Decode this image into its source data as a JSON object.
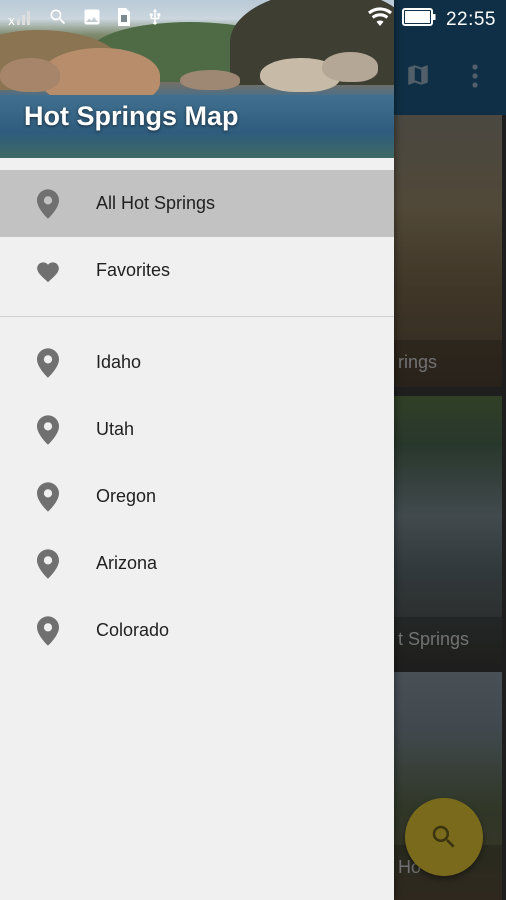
{
  "status_bar": {
    "time": "22:55",
    "icons": [
      "signal-x-icon",
      "search-icon",
      "image-icon",
      "sim-icon",
      "usb-icon",
      "wifi-icon",
      "battery-icon"
    ]
  },
  "drawer": {
    "title": "Hot Springs Map",
    "primary_items": [
      {
        "label": "All Hot Springs",
        "icon": "location-pin-icon",
        "selected": true
      },
      {
        "label": "Favorites",
        "icon": "heart-icon",
        "selected": false
      }
    ],
    "state_items": [
      {
        "label": "Idaho",
        "icon": "location-pin-icon"
      },
      {
        "label": "Utah",
        "icon": "location-pin-icon"
      },
      {
        "label": "Oregon",
        "icon": "location-pin-icon"
      },
      {
        "label": "Arizona",
        "icon": "location-pin-icon"
      },
      {
        "label": "Colorado",
        "icon": "location-pin-icon"
      }
    ]
  },
  "background": {
    "toolbar_actions": [
      "map-icon",
      "more-vert-icon"
    ],
    "cards": [
      {
        "label": "rings"
      },
      {
        "label": "t Springs"
      },
      {
        "label": "Ho"
      }
    ],
    "fab_icon": "search-icon"
  },
  "colors": {
    "toolbar": "#1d5a86",
    "drawer_bg": "#f0f0f0",
    "selected_bg": "#c2c2c2",
    "icon_gray": "#707070",
    "fab": "#c9a80f"
  }
}
